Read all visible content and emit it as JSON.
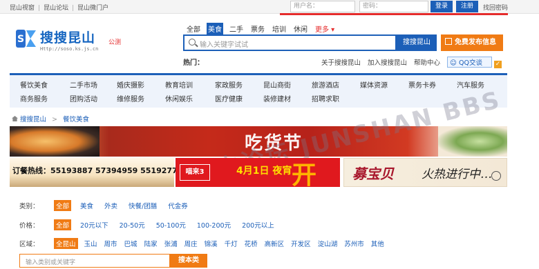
{
  "topbar": {
    "links": [
      "昆山视窗",
      "昆山论坛",
      "昆山微门户"
    ],
    "username_placeholder": "用户名：",
    "password_placeholder": "密码：",
    "login_label": "登录",
    "register_label": "注册",
    "find_password_label": "找回密码"
  },
  "logo": {
    "title": "搜搜昆山",
    "city": "公测",
    "url": "Http://soso.ks.js.cn"
  },
  "search": {
    "categories": [
      "全部",
      "美食",
      "二手",
      "票务",
      "培训",
      "休闲"
    ],
    "active_category": "美食",
    "more_label": "更多 ▾",
    "placeholder": "输入关键字试试",
    "button_label": "搜搜昆山",
    "post_label": "免费发布信息",
    "hot_label": "热门：",
    "links": [
      "关于搜搜昆山",
      "加入搜搜昆山",
      "帮助中心"
    ],
    "qq_label": "QQ交谈"
  },
  "nav": {
    "row1": [
      "餐饮美食",
      "二手市场",
      "婚庆摄影",
      "教育培训",
      "家政服务",
      "昆山商街",
      "旅游酒店",
      "媒体资源",
      "票务卡券",
      "汽车服务"
    ],
    "row2": [
      "商务服务",
      "团购活动",
      "维修服务",
      "休闲娱乐",
      "医疗健康",
      "装修建材",
      "招聘求职"
    ]
  },
  "breadcrumb": {
    "home": "搜搜昆山",
    "current": "餐饮美食"
  },
  "ads": {
    "banner_text": "吃货节",
    "watermark": "昆山论坛 JUNSHAN BBS",
    "hotline": "订餐热线：55193887 57394959 55192777",
    "ad2_brand": "喵来3",
    "ad2_date": "4月1日 夜宵",
    "ad2_big": "开始",
    "ad3_text1": "募宝贝",
    "ad3_text2": "火热进行中…"
  },
  "filters": {
    "category_label": "类别：",
    "category_options": [
      "全部",
      "美食",
      "外卖",
      "快餐/团膳",
      "代金券"
    ],
    "price_label": "价格：",
    "price_options": [
      "全部",
      "20元以下",
      "20-50元",
      "50-100元",
      "100-200元",
      "200元以上"
    ],
    "region_label": "区域：",
    "region_options": [
      "全昆山",
      "玉山",
      "周市",
      "巴城",
      "陆家",
      "张浦",
      "周庄",
      "锦溪",
      "千灯",
      "花桥",
      "高新区",
      "开发区",
      "淀山湖",
      "苏州市",
      "其他"
    ]
  },
  "merchant_search": {
    "placeholder": "输入类别或关键字",
    "button_label": "搜本类"
  },
  "colors": {
    "brand_blue": "#1c5fb8",
    "accent_orange": "#f07b14",
    "accent_red": "#e52b2b"
  }
}
